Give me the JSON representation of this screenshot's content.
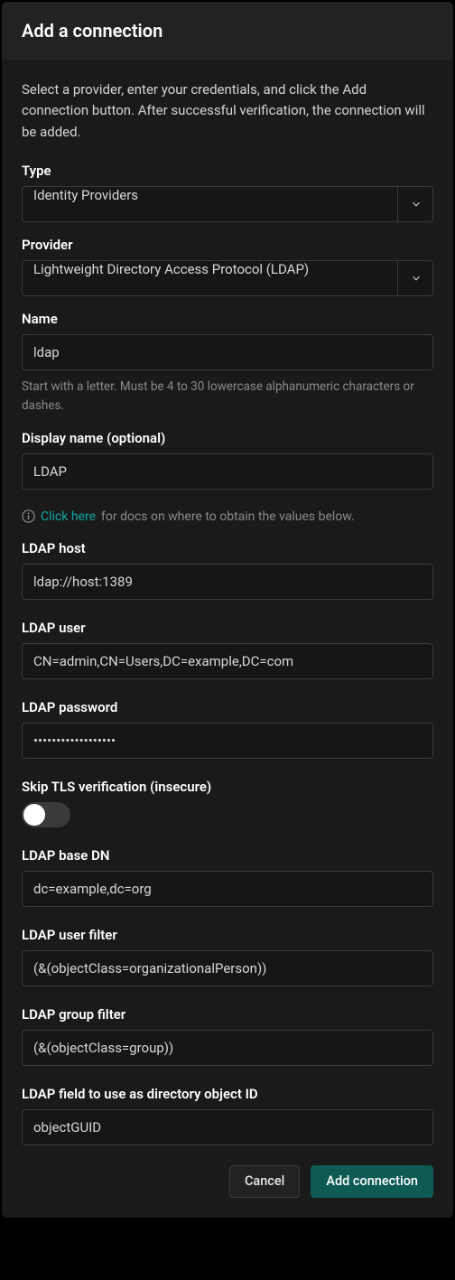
{
  "header": {
    "title": "Add a connection"
  },
  "intro": "Select a provider, enter your credentials, and click the Add connection button. After successful verification, the connection will be added.",
  "fields": {
    "type": {
      "label": "Type",
      "value": "Identity Providers"
    },
    "provider": {
      "label": "Provider",
      "value": "Lightweight Directory Access Protocol (LDAP)"
    },
    "name": {
      "label": "Name",
      "value": "ldap",
      "hint": "Start with a letter. Must be 4 to 30 lowercase alphanumeric characters or dashes."
    },
    "display_name": {
      "label": "Display name (optional)",
      "value": "LDAP"
    },
    "docs": {
      "link": "Click here",
      "rest": "for docs on where to obtain the values below."
    },
    "ldap_host": {
      "label": "LDAP host",
      "value": "ldap://host:1389"
    },
    "ldap_user": {
      "label": "LDAP user",
      "value": "CN=admin,CN=Users,DC=example,DC=com"
    },
    "ldap_password": {
      "label": "LDAP password",
      "value": "••••••••••••••••••"
    },
    "skip_tls": {
      "label": "Skip TLS verification (insecure)",
      "value": false
    },
    "ldap_base_dn": {
      "label": "LDAP base DN",
      "value": "dc=example,dc=org"
    },
    "ldap_user_filter": {
      "label": "LDAP user filter",
      "value": "(&(objectClass=organizationalPerson))"
    },
    "ldap_group_filter": {
      "label": "LDAP group filter",
      "value": "(&(objectClass=group))"
    },
    "ldap_field_id": {
      "label": "LDAP field to use as directory object ID",
      "value": "objectGUID"
    }
  },
  "footer": {
    "cancel": "Cancel",
    "submit": "Add connection"
  }
}
